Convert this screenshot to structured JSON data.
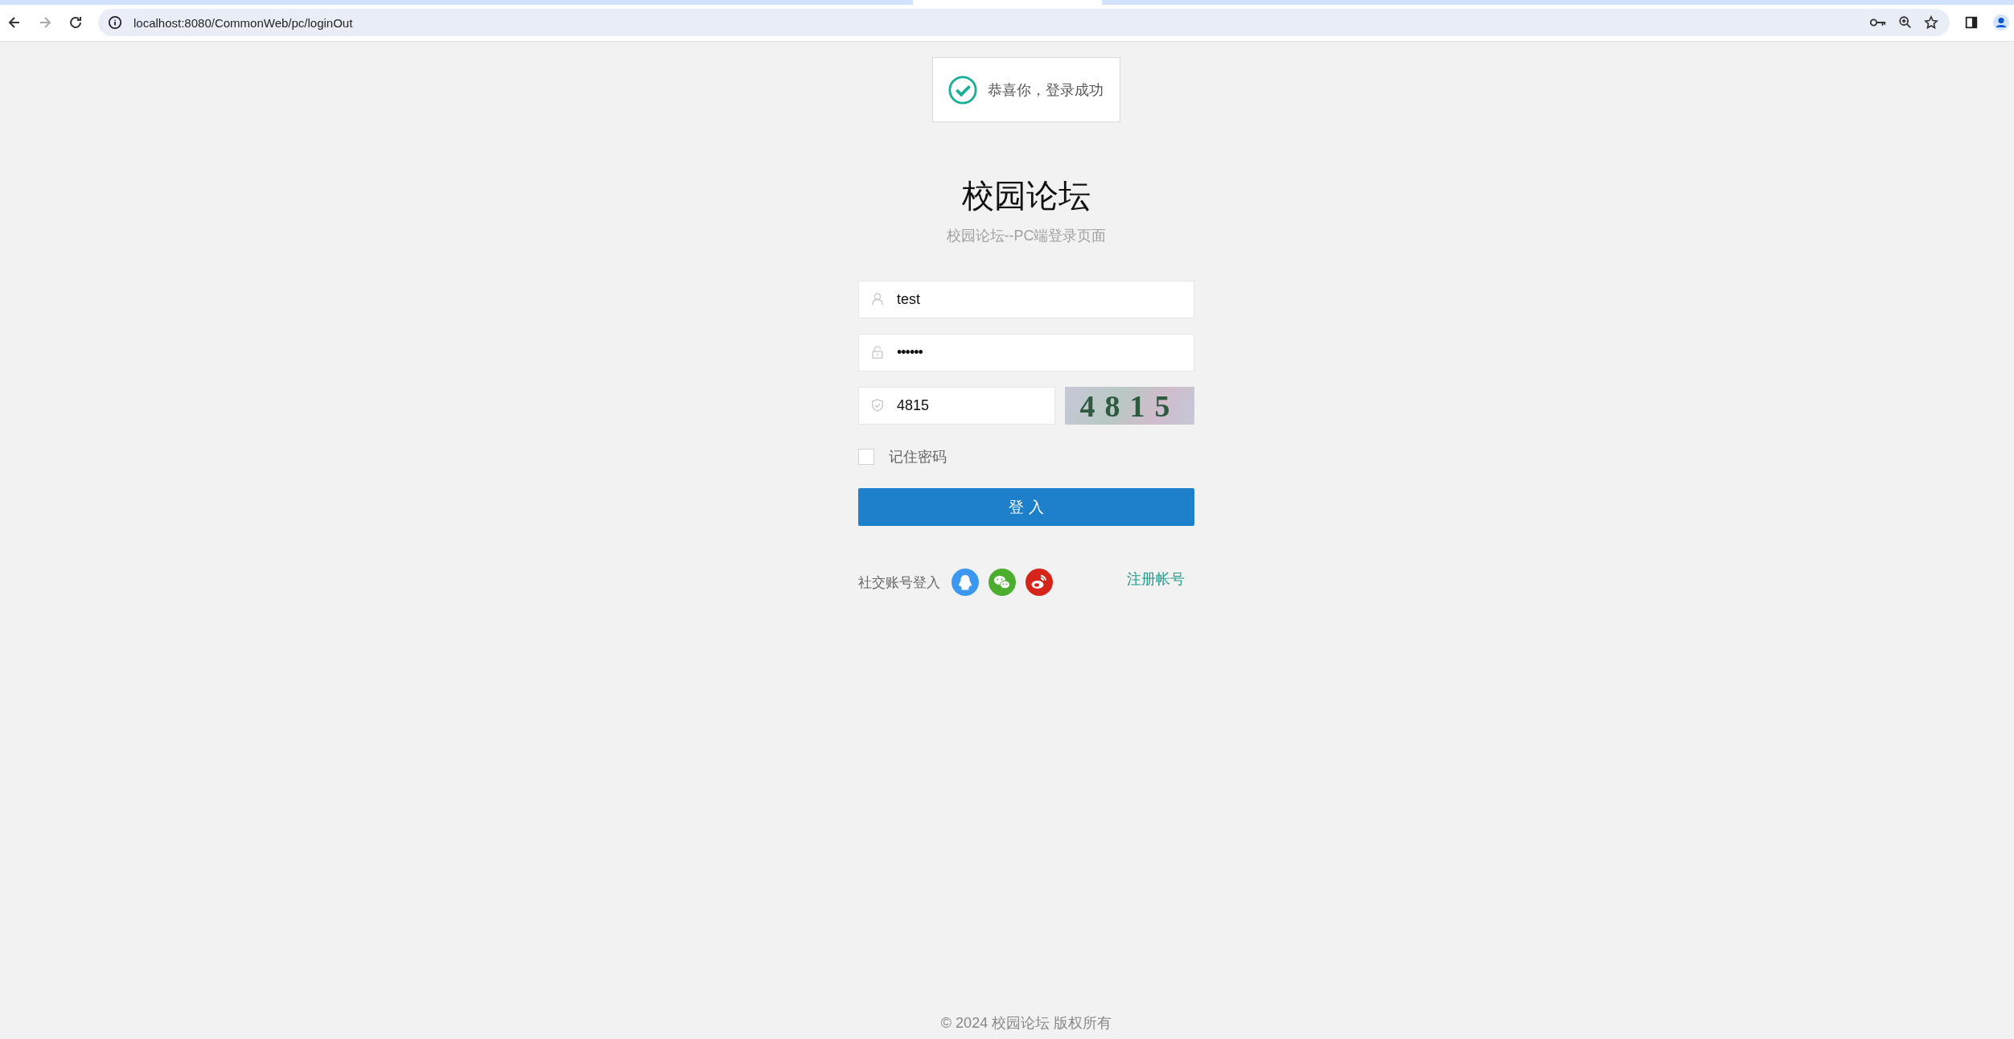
{
  "browser": {
    "url": "localhost:8080/CommonWeb/pc/loginOut",
    "back_disabled": false,
    "forward_disabled": true
  },
  "toast": {
    "message": "恭喜你，登录成功"
  },
  "header": {
    "title": "校园论坛",
    "subtitle": "校园论坛--PC端登录页面"
  },
  "form": {
    "fields": [
      {
        "kind": "user",
        "value": "test"
      },
      {
        "kind": "password",
        "value": "••••••"
      },
      {
        "kind": "captcha",
        "value": "4815"
      }
    ],
    "captcha_image": "4815",
    "remember": {
      "label": "记住密码",
      "checked": false
    },
    "submit": "登 入"
  },
  "social": {
    "label": "社交账号登入",
    "icons": [
      {
        "kind": "qq",
        "color": "#3b97ef"
      },
      {
        "kind": "wechat",
        "color": "#4cae2e"
      },
      {
        "kind": "weibo",
        "color": "#d5241a"
      }
    ],
    "register_link": "注册帐号"
  },
  "footer": "© 2024 校园论坛 版权所有"
}
